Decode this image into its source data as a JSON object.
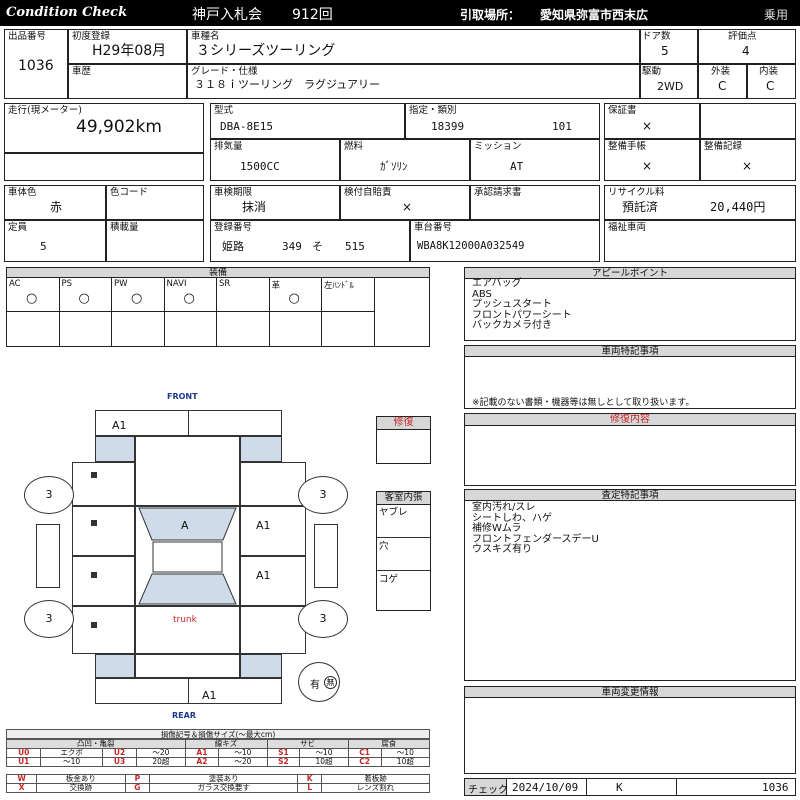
{
  "header": {
    "left": "Condition  Check",
    "auction": "神戸入札会",
    "lot_no": "912回",
    "pickup_label": "引取場所：",
    "pickup_value": "愛知県弥富市西末広",
    "category": "乗用",
    "bg_color": "#000000"
  },
  "vehicle": {
    "listing_no_label": "出品番号",
    "listing_no": "1036",
    "first_reg_label": "初度登録",
    "first_reg": "H29年08月",
    "history_label": "車歴",
    "model_name_label": "車種名",
    "model_name": "３シリーズツーリング",
    "grade_label": "グレード・仕様",
    "grade": "３１８ｉツーリング　ラグジュアリー",
    "doors_label": "ドア数",
    "doors": "5",
    "score_label": "評価点",
    "score": "4",
    "drive_label": "駆動",
    "drive": "2WD",
    "exterior_label": "外装",
    "exterior": "C",
    "interior_label": "内装",
    "interior": "C",
    "mileage_label": "走行(現メーター)",
    "mileage": "49,902km",
    "type_label": "型式",
    "type": "DBA-8E15",
    "designation_label": "指定・類別",
    "designation": "18399",
    "classification": "101",
    "warranty_label": "保証書",
    "warranty": "×",
    "displacement_label": "排気量",
    "displacement": "1500CC",
    "fuel_label": "燃料",
    "fuel": "ｶﾞｿﾘﾝ",
    "transmission_label": "ミッション",
    "transmission": "AT",
    "manual_label": "整備手帳",
    "manual": "×",
    "records_label": "整備記録",
    "records": "×",
    "body_color_label": "車体色",
    "body_color": "赤",
    "color_code_label": "色コード",
    "inspection_label": "車検期限",
    "inspection": "抹消",
    "liability_label": "検付自賠責",
    "liability": "×",
    "approval_label": "承認請求書",
    "recycle_label": "リサイクル料",
    "recycle_status": "預託済",
    "recycle_fee": "20,440円",
    "capacity_label": "定員",
    "capacity": "5",
    "load_label": "積載量",
    "plate_label": "登録番号",
    "plate_area": "姫路",
    "plate_class": "349",
    "plate_kana": "そ",
    "plate_no": "515",
    "chassis_label": "車台番号",
    "chassis": "WBA8K12000A032549",
    "welfare_label": "福祉車両"
  },
  "equipment": {
    "title": "装備",
    "items": [
      {
        "label": "AC",
        "value": "○"
      },
      {
        "label": "PS",
        "value": "○"
      },
      {
        "label": "PW",
        "value": "○"
      },
      {
        "label": "NAVI",
        "value": "○"
      },
      {
        "label": "SR",
        "value": ""
      },
      {
        "label": "革",
        "value": "○"
      },
      {
        "label": "左ﾊﾝﾄﾞﾙ",
        "value": ""
      }
    ]
  },
  "appeal": {
    "title": "アピールポイント",
    "lines": [
      "エアバッグ",
      "ABS",
      "プッシュスタート",
      "フロントパワーシート",
      "バックカメラ付き"
    ]
  },
  "special": {
    "title": "車両特記事項",
    "note": "※記載のない書類・機器等は無しとして取り扱います。"
  },
  "repair_content": {
    "title": "修復内容"
  },
  "inspection_notes": {
    "title": "査定特記事項",
    "lines": [
      "室内汚れ/スレ",
      "シートしわ、ハゲ",
      "補修Wムラ",
      "フロントフェンダースデーU",
      "ウスキズ有り"
    ]
  },
  "change_info": {
    "title": "車両変更情報"
  },
  "footer": {
    "check_label": "チェック",
    "date": "2024/10/09",
    "checker": "K",
    "number": "1036"
  },
  "diagram": {
    "front": "FRONT",
    "rear": "REAR",
    "trunk": "trunk",
    "marks": {
      "front_bumper": "A1",
      "rear_bumper": "A1",
      "roof": "A",
      "right_front_door": "A1",
      "right_rear_door": "A1"
    },
    "tires": [
      "3",
      "3",
      "3",
      "3"
    ],
    "ink": "有",
    "ink_circle": "無",
    "repair_box": "修復",
    "interior_box": {
      "title": "客室内張",
      "rows": [
        "ヤブレ",
        "穴",
        "コゲ"
      ]
    }
  },
  "legend": {
    "title": "損傷記号＆損傷サイズ(〜最大cm)",
    "groups": [
      "凸凹・亀裂",
      "線キズ",
      "サビ",
      "腐食"
    ],
    "row1": [
      [
        "U0",
        "エクボ"
      ],
      [
        "U2",
        "〜20"
      ],
      [
        "A1",
        "〜10"
      ],
      [
        "S1",
        "〜10"
      ],
      [
        "C1",
        "〜10"
      ]
    ],
    "row2": [
      [
        "U1",
        "〜10"
      ],
      [
        "U3",
        "20超"
      ],
      [
        "A2",
        "〜20"
      ],
      [
        "S2",
        "10超"
      ],
      [
        "C2",
        "10超"
      ]
    ],
    "row3": [
      [
        "W",
        "板金あり"
      ],
      [
        "P",
        "塗装あり"
      ],
      [
        "K",
        "着板跡"
      ]
    ],
    "row4": [
      [
        "X",
        "交換跡"
      ],
      [
        "G",
        "ガラス交換要す"
      ],
      [
        "L",
        "レンズ割れ"
      ]
    ]
  }
}
